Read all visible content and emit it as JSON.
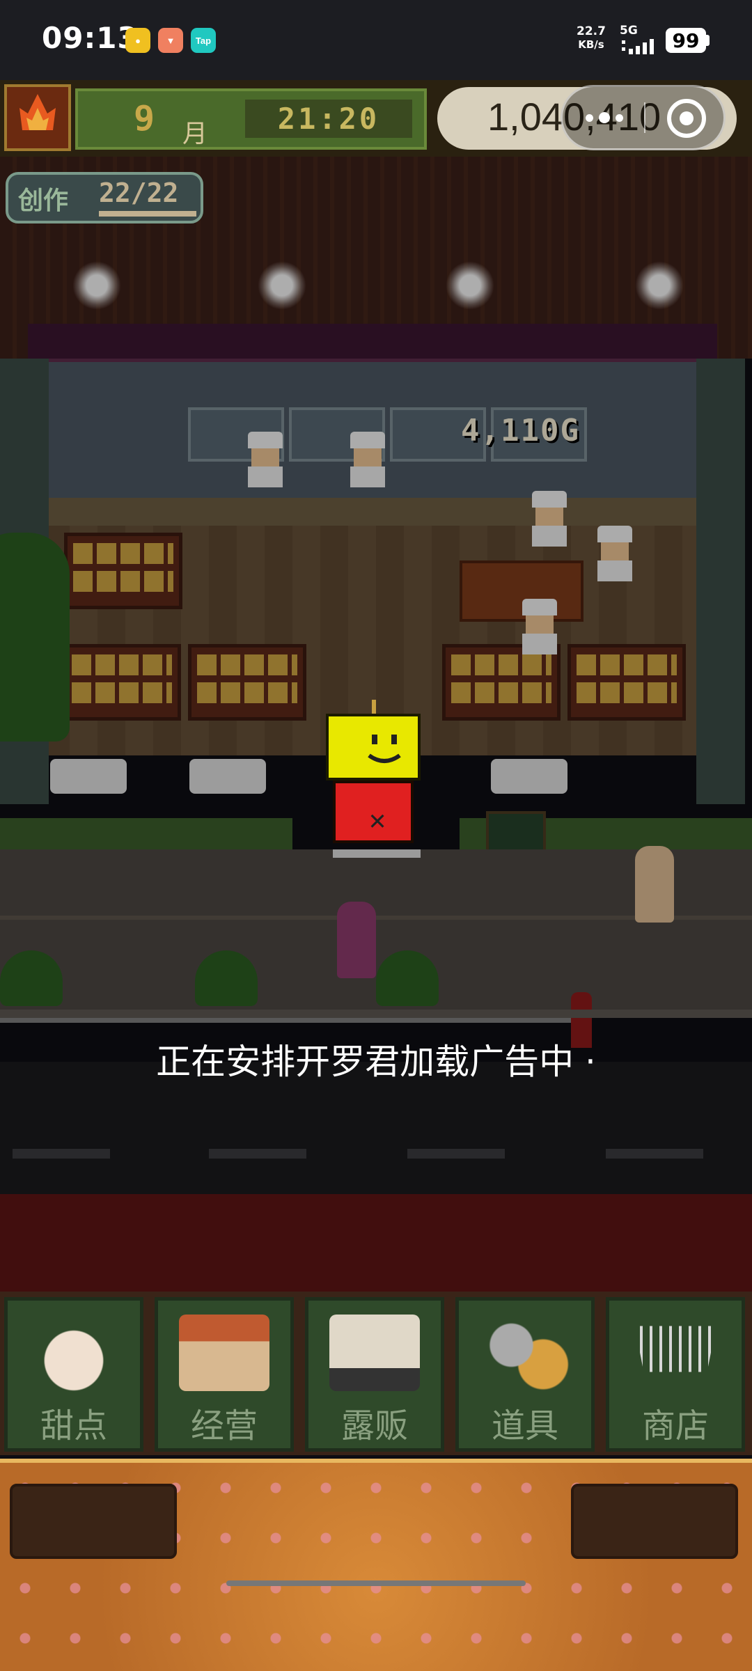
{
  "status_bar": {
    "time": "09:13",
    "network_speed_value": "22.7",
    "network_speed_unit": "KB/s",
    "network_type": "5G",
    "battery": "99",
    "app_icons": [
      "app-icon-1",
      "app-icon-2",
      "tap-icon"
    ],
    "tap_label": "Tap"
  },
  "hud": {
    "month": "9",
    "month_label": "月",
    "time": "21:20",
    "money": "1,040,410"
  },
  "create": {
    "label": "创作",
    "count": "22/22"
  },
  "scene": {
    "gold_popup": "4,110G"
  },
  "loading_text": "正在安排开罗君加载广告中 ·",
  "nav": {
    "items": [
      {
        "label": "甜点",
        "icon": "cake-icon"
      },
      {
        "label": "经营",
        "icon": "shop-building-icon"
      },
      {
        "label": "露贩",
        "icon": "food-truck-icon"
      },
      {
        "label": "道具",
        "icon": "gear-bag-icon"
      },
      {
        "label": "商店",
        "icon": "shopping-cart-icon"
      }
    ]
  },
  "colors": {
    "hud_green": "#4a6a2a",
    "nav_green": "#2f4a2a",
    "robot_head": "#e8e800",
    "robot_body": "#e02020"
  }
}
